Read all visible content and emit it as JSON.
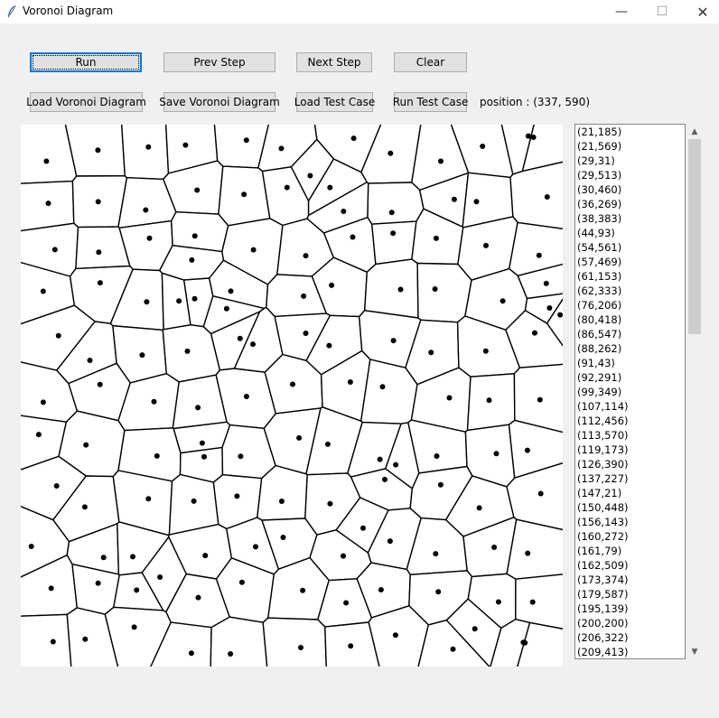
{
  "window": {
    "title": "Voronoi Diagram",
    "controls": {
      "minimize": "—",
      "maximize": "☐",
      "close": "✕"
    }
  },
  "toolbar": {
    "run": "Run",
    "prev_step": "Prev Step",
    "next_step": "Next Step",
    "clear": "Clear",
    "load_voronoi": "Load Voronoi Diagram",
    "save_voronoi": "Save Voronoi Diagram",
    "load_test_case": "Load Test Case",
    "run_test_case": "Run Test Case",
    "position": "position : (337, 590)"
  },
  "points": [
    "(21,185)",
    "(21,569)",
    "(29,31)",
    "(29,513)",
    "(30,460)",
    "(36,269)",
    "(38,383)",
    "(44,93)",
    "(54,561)",
    "(57,469)",
    "(61,153)",
    "(62,333)",
    "(76,206)",
    "(80,418)",
    "(86,547)",
    "(88,262)",
    "(91,43)",
    "(92,291)",
    "(99,349)",
    "(107,114)",
    "(112,456)",
    "(113,570)",
    "(119,173)",
    "(126,390)",
    "(137,227)",
    "(147,21)",
    "(150,448)",
    "(156,143)",
    "(160,272)",
    "(161,79)",
    "(162,509)",
    "(173,374)",
    "(179,587)",
    "(195,139)",
    "(200,200)",
    "(206,322)",
    "(209,413)"
  ]
}
